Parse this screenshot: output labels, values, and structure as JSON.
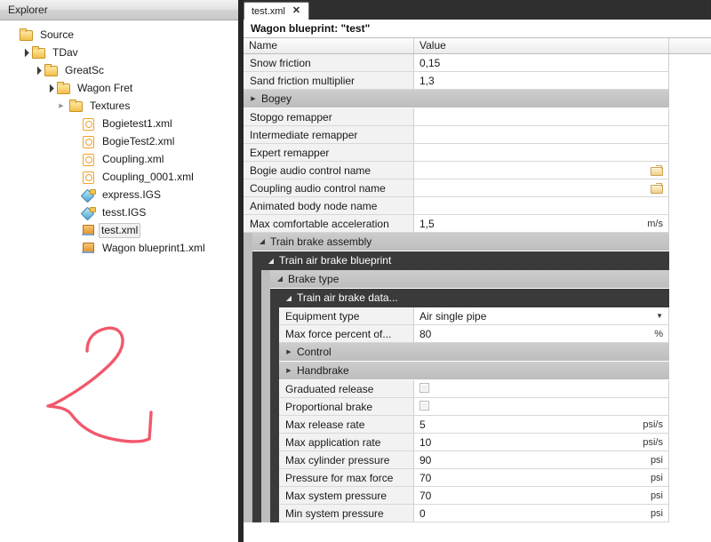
{
  "explorer": {
    "title": "Explorer",
    "tree": [
      {
        "label": "Source",
        "depth": 0,
        "icon": "folder",
        "state": "none",
        "selected": false
      },
      {
        "label": "TDav",
        "depth": 1,
        "icon": "folder",
        "state": "open",
        "selected": false
      },
      {
        "label": "GreatSc",
        "depth": 2,
        "icon": "folder",
        "state": "open",
        "selected": false
      },
      {
        "label": "Wagon Fret",
        "depth": 3,
        "icon": "folder",
        "state": "open",
        "selected": false
      },
      {
        "label": "Textures",
        "depth": 4,
        "icon": "folder",
        "state": "closed",
        "selected": false
      },
      {
        "label": "Bogietest1.xml",
        "depth": 5,
        "icon": "xml-circle",
        "state": "none",
        "selected": false
      },
      {
        "label": "BogieTest2.xml",
        "depth": 5,
        "icon": "xml-circle",
        "state": "none",
        "selected": false
      },
      {
        "label": "Coupling.xml",
        "depth": 5,
        "icon": "xml-circle",
        "state": "none",
        "selected": false
      },
      {
        "label": "Coupling_0001.xml",
        "depth": 5,
        "icon": "xml-circle",
        "state": "none",
        "selected": false
      },
      {
        "label": "express.IGS",
        "depth": 5,
        "icon": "igs-model",
        "state": "none",
        "selected": false
      },
      {
        "label": "tesst.IGS",
        "depth": 5,
        "icon": "igs-model",
        "state": "none",
        "selected": false
      },
      {
        "label": "test.xml",
        "depth": 5,
        "icon": "blueprint-box",
        "state": "none",
        "selected": true
      },
      {
        "label": "Wagon blueprint1.xml",
        "depth": 5,
        "icon": "blueprint-box",
        "state": "none",
        "selected": false
      }
    ],
    "annotation": {
      "name": "red-ink-annotation",
      "color": "#f2586b"
    }
  },
  "editor": {
    "tab": {
      "title": "test.xml",
      "close": "✕"
    },
    "doc_title": "Wagon blueprint: \"test\"",
    "columns": {
      "name": "Name",
      "value": "Value"
    },
    "rows": [
      {
        "kind": "prop",
        "level": 0,
        "name": "Snow friction",
        "value": "0,15",
        "unit": "",
        "control": "text"
      },
      {
        "kind": "prop",
        "level": 0,
        "name": "Sand friction multiplier",
        "value": "1,3",
        "unit": "",
        "control": "text"
      },
      {
        "kind": "group",
        "level": 0,
        "name": "Bogey",
        "state": "closed",
        "style": "light"
      },
      {
        "kind": "prop",
        "level": 0,
        "name": "Stopgo remapper",
        "value": "",
        "unit": "",
        "control": "text"
      },
      {
        "kind": "prop",
        "level": 0,
        "name": "Intermediate remapper",
        "value": "",
        "unit": "",
        "control": "text"
      },
      {
        "kind": "prop",
        "level": 0,
        "name": "Expert remapper",
        "value": "",
        "unit": "",
        "control": "text"
      },
      {
        "kind": "prop",
        "level": 0,
        "name": "Bogie audio control name",
        "value": "",
        "unit": "",
        "control": "browse"
      },
      {
        "kind": "prop",
        "level": 0,
        "name": "Coupling audio control name",
        "value": "",
        "unit": "",
        "control": "browse"
      },
      {
        "kind": "prop",
        "level": 0,
        "name": "Animated body node name",
        "value": "",
        "unit": "",
        "control": "text"
      },
      {
        "kind": "prop",
        "level": 0,
        "name": "Max comfortable acceleration",
        "value": "1,5",
        "unit": "m/s",
        "control": "text"
      },
      {
        "kind": "group",
        "level": 1,
        "name": "Train brake assembly",
        "state": "open",
        "style": "light"
      },
      {
        "kind": "group",
        "level": 2,
        "name": "Train air brake blueprint",
        "state": "open",
        "style": "dark"
      },
      {
        "kind": "group",
        "level": 3,
        "name": "Brake type",
        "state": "open",
        "style": "light"
      },
      {
        "kind": "group",
        "level": 4,
        "name": "Train air brake data...",
        "state": "open",
        "style": "dark"
      },
      {
        "kind": "prop",
        "level": 4,
        "name": "Equipment type",
        "value": "Air single pipe",
        "unit": "",
        "control": "dropdown"
      },
      {
        "kind": "prop",
        "level": 4,
        "name": "Max force percent of...",
        "value": "80",
        "unit": "%",
        "control": "text"
      },
      {
        "kind": "group",
        "level": 4,
        "name": "Control",
        "state": "closed",
        "style": "light"
      },
      {
        "kind": "group",
        "level": 4,
        "name": "Handbrake",
        "state": "closed",
        "style": "light"
      },
      {
        "kind": "prop",
        "level": 4,
        "name": "Graduated release",
        "value": "",
        "unit": "",
        "control": "checkbox",
        "checked": false
      },
      {
        "kind": "prop",
        "level": 4,
        "name": "Proportional brake",
        "value": "",
        "unit": "",
        "control": "checkbox",
        "checked": false
      },
      {
        "kind": "prop",
        "level": 4,
        "name": "Max release rate",
        "value": "5",
        "unit": "psi/s",
        "control": "text"
      },
      {
        "kind": "prop",
        "level": 4,
        "name": "Max application rate",
        "value": "10",
        "unit": "psi/s",
        "control": "text"
      },
      {
        "kind": "prop",
        "level": 4,
        "name": "Max cylinder pressure",
        "value": "90",
        "unit": "psi",
        "control": "text"
      },
      {
        "kind": "prop",
        "level": 4,
        "name": "Pressure for max force",
        "value": "70",
        "unit": "psi",
        "control": "text"
      },
      {
        "kind": "prop",
        "level": 4,
        "name": "Max system pressure",
        "value": "70",
        "unit": "psi",
        "control": "text"
      },
      {
        "kind": "prop",
        "level": 4,
        "name": "Min system pressure",
        "value": "0",
        "unit": "psi",
        "control": "text"
      }
    ]
  },
  "colors": {
    "tabstrip_bg": "#2d2d2d",
    "group_dark": "#3a3a3a",
    "group_light": "#c4c4c4",
    "row_name_bg": "#f2f2f2",
    "annotation": "#f2586b",
    "folder_icon": "#f3c04a",
    "selection": "#f0f0f0"
  }
}
